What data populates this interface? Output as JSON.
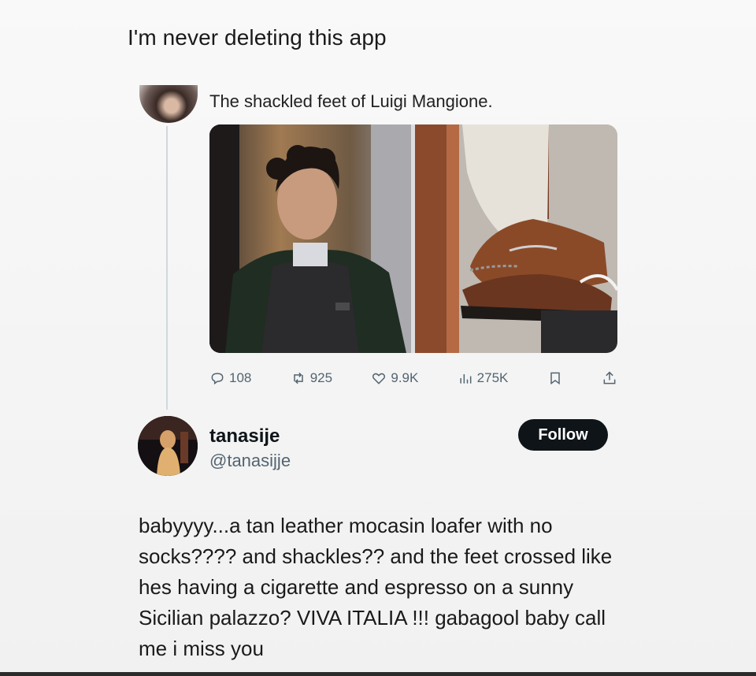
{
  "post": {
    "caption": "I'm never deleting this app"
  },
  "quoted_tweet": {
    "text": "The shackled feet of Luigi Mangione.",
    "stats": {
      "replies": "108",
      "retweets": "925",
      "likes": "9.9K",
      "views": "275K"
    }
  },
  "reply": {
    "display_name": "tanasije",
    "handle": "@tanasijje",
    "follow_label": "Follow",
    "body": "babyyyy...a tan leather mocasin loafer with no socks???? and shackles?? and the feet crossed like hes having a cigarette and espresso on a sunny Sicilian palazzo? VIVA ITALIA !!! gabagool baby call me i miss you"
  },
  "icons": {
    "reply": "speech-bubble-icon",
    "retweet": "retweet-icon",
    "like": "heart-icon",
    "views": "bar-chart-icon",
    "bookmark": "bookmark-icon",
    "share": "share-icon"
  },
  "colors": {
    "follow_bg": "#0f1419",
    "muted_text": "#536471",
    "thread_line": "#cfd9de"
  }
}
